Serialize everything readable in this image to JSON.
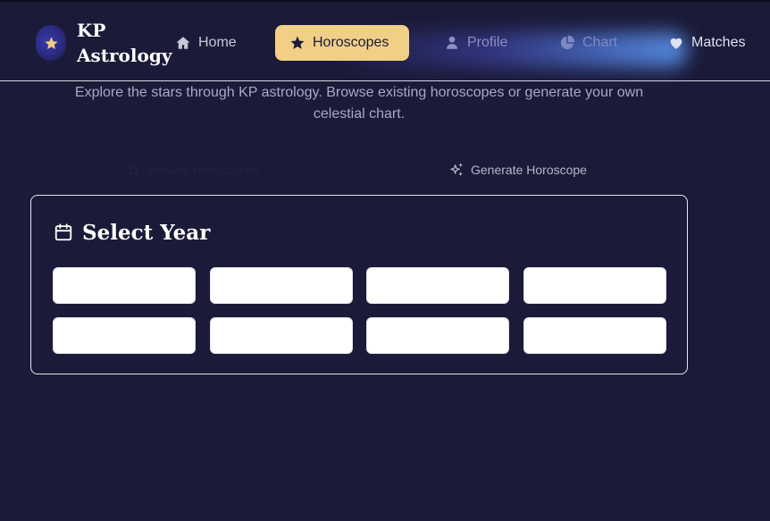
{
  "header": {
    "brand_line1": "KP",
    "brand_line2": "Astrology",
    "nav": {
      "home": {
        "label": "Home",
        "icon": "home-icon"
      },
      "horoscopes": {
        "label": "Horoscopes",
        "icon": "star-icon",
        "active": true
      },
      "profile": {
        "label": "Profile",
        "icon": "user-icon"
      },
      "chart": {
        "label": "Chart",
        "icon": "pie-chart-icon"
      },
      "matches": {
        "label": "Matches",
        "icon": "heart-icon"
      }
    }
  },
  "intro": {
    "text": "Explore the stars through KP astrology. Browse existing horoscopes or generate your own celestial chart."
  },
  "tabs": {
    "browse": {
      "label": "Browse Horoscopes",
      "icon": "star-outline-icon"
    },
    "generate": {
      "label": "Generate Horoscope",
      "icon": "sparkles-icon"
    }
  },
  "year_card": {
    "title": "Select Year",
    "icon": "calendar-icon",
    "years": [
      "",
      "",
      "",
      "",
      "",
      "",
      "",
      ""
    ]
  },
  "colors": {
    "background": "#1b1a38",
    "accent": "#f1cf86",
    "text_muted": "#a9a9c2"
  }
}
